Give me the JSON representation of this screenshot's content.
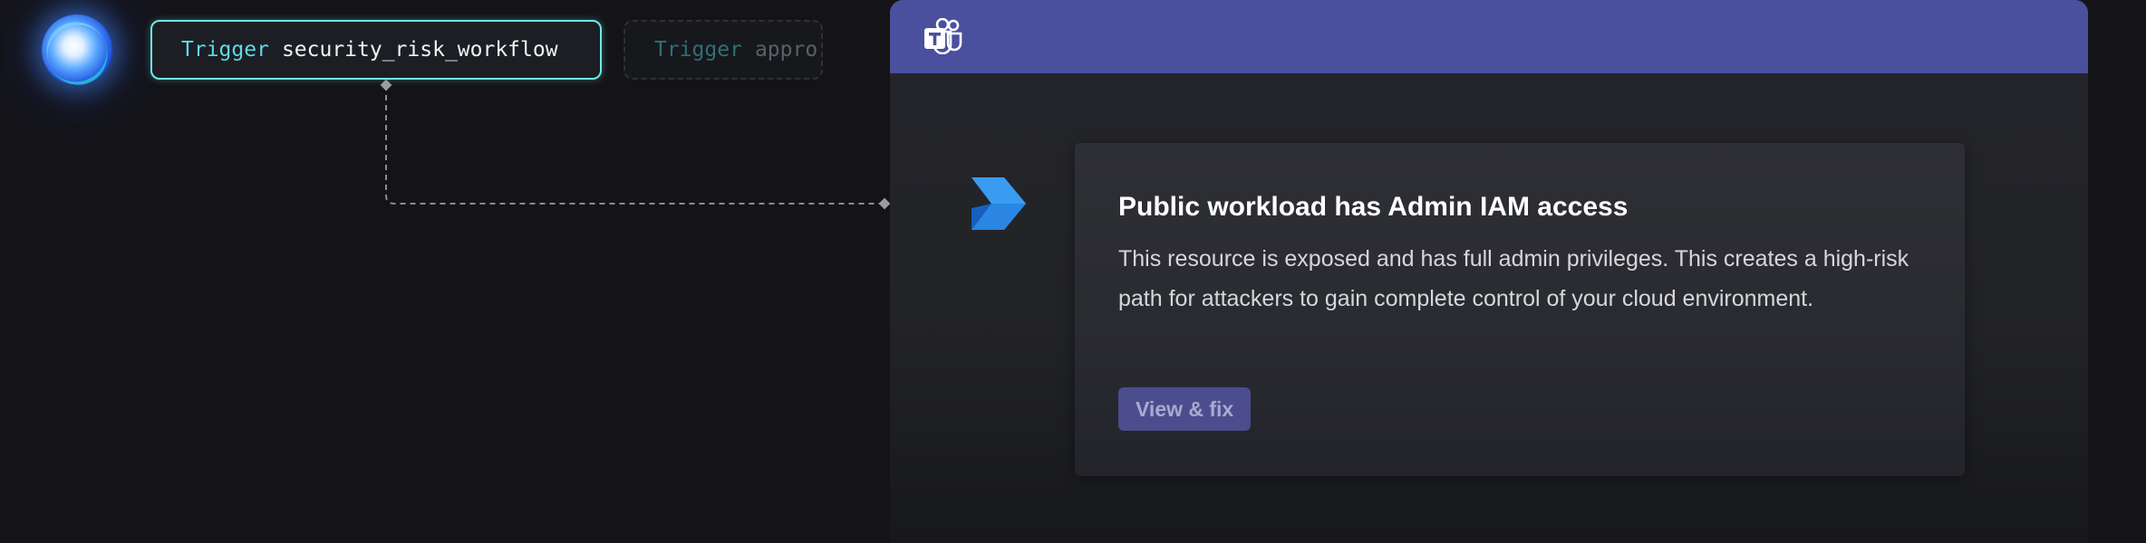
{
  "triggers": [
    {
      "keyword": "Trigger",
      "workflow": "security_risk_workflow"
    },
    {
      "keyword": "Trigger",
      "workflow": "appro"
    }
  ],
  "notification": {
    "title": "Public workload has Admin IAM access",
    "body": "This resource is exposed and has full admin privileges. This creates a high-risk path for attackers to gain complete control of your cloud environment.",
    "action_label": "View & fix"
  },
  "icons": {
    "logo": "orb-logo-icon",
    "teams": "microsoft-teams-icon",
    "bot": "azure-bot-icon"
  },
  "colors": {
    "teams_header": "#4a4f9e",
    "trigger_border": "#6fe8e8",
    "trigger_keyword": "#5fd9e6",
    "button_bg": "#4b4d8e",
    "background": "#141418"
  }
}
